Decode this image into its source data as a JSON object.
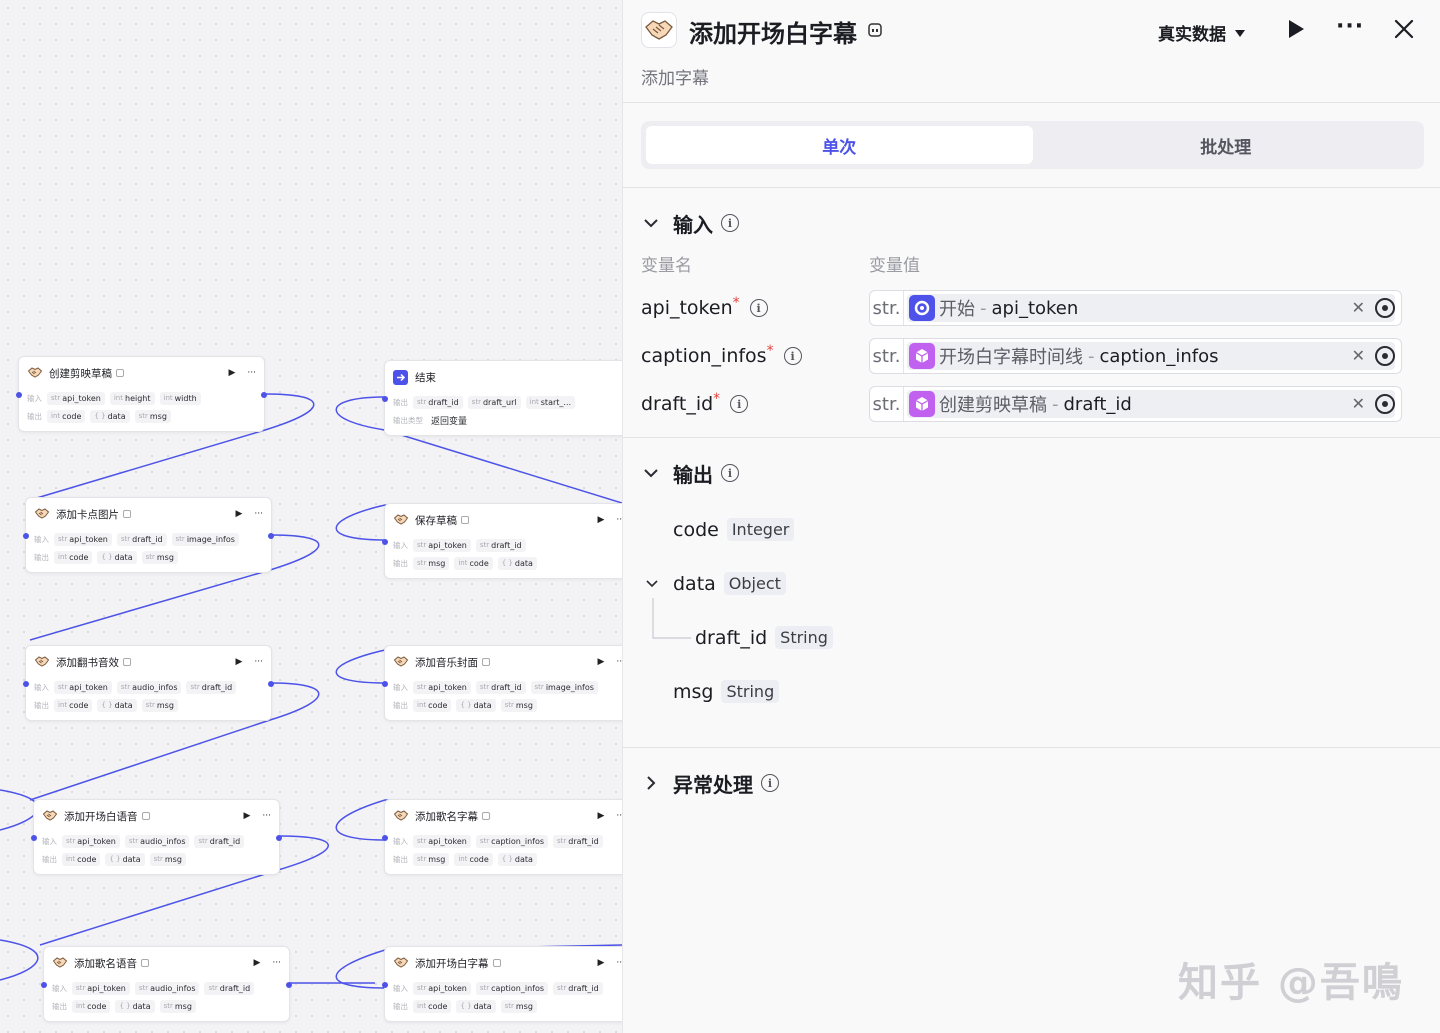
{
  "canvas": {
    "io_labels": {
      "input": "输入",
      "output": "输出",
      "output_type": "输出类型"
    },
    "nodes": [
      {
        "id": "n1",
        "title": "创建剪映草稿",
        "inputs": [
          [
            "str",
            "api_token"
          ],
          [
            "int",
            "height"
          ],
          [
            "int",
            "width"
          ]
        ],
        "outputs": [
          [
            "int",
            "code"
          ],
          [
            "{ }",
            "data"
          ],
          [
            "str",
            "msg"
          ]
        ]
      },
      {
        "id": "n2",
        "title": "添加卡点图片",
        "inputs": [
          [
            "str",
            "api_token"
          ],
          [
            "str",
            "draft_id"
          ],
          [
            "str",
            "image_infos"
          ]
        ],
        "outputs": [
          [
            "int",
            "code"
          ],
          [
            "{ }",
            "data"
          ],
          [
            "str",
            "msg"
          ]
        ]
      },
      {
        "id": "n3",
        "title": "添加翻书音效",
        "inputs": [
          [
            "str",
            "api_token"
          ],
          [
            "str",
            "audio_infos"
          ],
          [
            "str",
            "draft_id"
          ]
        ],
        "outputs": [
          [
            "int",
            "code"
          ],
          [
            "{ }",
            "data"
          ],
          [
            "str",
            "msg"
          ]
        ]
      },
      {
        "id": "n4",
        "title": "添加开场白语音",
        "inputs": [
          [
            "str",
            "api_token"
          ],
          [
            "str",
            "audio_infos"
          ],
          [
            "str",
            "draft_id"
          ]
        ],
        "outputs": [
          [
            "int",
            "code"
          ],
          [
            "{ }",
            "data"
          ],
          [
            "str",
            "msg"
          ]
        ]
      },
      {
        "id": "n5",
        "title": "添加歌名语音",
        "inputs": [
          [
            "str",
            "api_token"
          ],
          [
            "str",
            "audio_infos"
          ],
          [
            "str",
            "draft_id"
          ]
        ],
        "outputs": [
          [
            "int",
            "code"
          ],
          [
            "{ }",
            "data"
          ],
          [
            "str",
            "msg"
          ]
        ]
      },
      {
        "id": "n6",
        "title": "结束",
        "outputs": [
          [
            "str",
            "draft_id"
          ],
          [
            "str",
            "draft_url"
          ],
          [
            "int",
            "start_..."
          ]
        ],
        "output_type": "返回变量"
      },
      {
        "id": "n7",
        "title": "保存草稿",
        "inputs": [
          [
            "str",
            "api_token"
          ],
          [
            "str",
            "draft_id"
          ]
        ],
        "outputs": [
          [
            "str",
            "msg"
          ],
          [
            "int",
            "code"
          ],
          [
            "{ }",
            "data"
          ]
        ]
      },
      {
        "id": "n8",
        "title": "添加音乐封面",
        "inputs": [
          [
            "str",
            "api_token"
          ],
          [
            "str",
            "draft_id"
          ],
          [
            "str",
            "image_infos"
          ]
        ],
        "outputs": [
          [
            "int",
            "code"
          ],
          [
            "{ }",
            "data"
          ],
          [
            "str",
            "msg"
          ]
        ]
      },
      {
        "id": "n9",
        "title": "添加歌名字幕",
        "inputs": [
          [
            "str",
            "api_token"
          ],
          [
            "str",
            "caption_infos"
          ],
          [
            "str",
            "draft_id"
          ]
        ],
        "outputs": [
          [
            "str",
            "msg"
          ],
          [
            "int",
            "code"
          ],
          [
            "{ }",
            "data"
          ]
        ]
      },
      {
        "id": "n10",
        "title": "添加开场白字幕",
        "inputs": [
          [
            "str",
            "api_token"
          ],
          [
            "str",
            "caption_infos"
          ],
          [
            "str",
            "draft_id"
          ]
        ],
        "outputs": [
          [
            "int",
            "code"
          ],
          [
            "{ }",
            "data"
          ],
          [
            "str",
            "msg"
          ]
        ]
      }
    ]
  },
  "panel": {
    "title": "添加开场白字幕",
    "subtitle": "添加字幕",
    "data_mode": "真实数据",
    "tabs": [
      "单次",
      "批处理"
    ],
    "input_section": {
      "title": "输入",
      "col_name": "变量名",
      "col_value": "变量值",
      "rows": [
        {
          "name": "api_token",
          "type": "str.",
          "source_node": "开始",
          "source_var": "api_token",
          "icon_color": "#4d53e8"
        },
        {
          "name": "caption_infos",
          "type": "str.",
          "source_node": "开场白字幕时间线",
          "source_var": "caption_infos",
          "icon_color": "#c061f0"
        },
        {
          "name": "draft_id",
          "type": "str.",
          "source_node": "创建剪映草稿",
          "source_var": "draft_id",
          "icon_color": "#c061f0"
        }
      ]
    },
    "output_section": {
      "title": "输出",
      "fields": {
        "code": {
          "name": "code",
          "type": "Integer"
        },
        "data": {
          "name": "data",
          "type": "Object"
        },
        "draft_id": {
          "name": "draft_id",
          "type": "String"
        },
        "msg": {
          "name": "msg",
          "type": "String"
        }
      }
    },
    "error_section": {
      "title": "异常处理"
    }
  },
  "watermark": "知乎 @吾鳴",
  "colors": {
    "accent": "#4d53e8",
    "required": "#e0413a",
    "plugin_icon": "#c061f0"
  }
}
